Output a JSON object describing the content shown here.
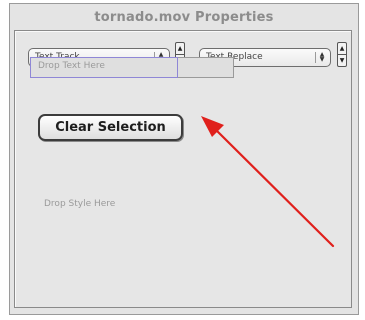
{
  "window": {
    "title": "tornado.mov Properties"
  },
  "popups": {
    "track_label": "Text Track",
    "action_label": "Text Replace"
  },
  "drop_text": {
    "placeholder": "Drop Text Here"
  },
  "clear_button": {
    "label": "Clear Selection"
  },
  "drop_style": {
    "label": "Drop Style Here"
  },
  "annotation": {
    "arrow_color": "#e0201c"
  }
}
